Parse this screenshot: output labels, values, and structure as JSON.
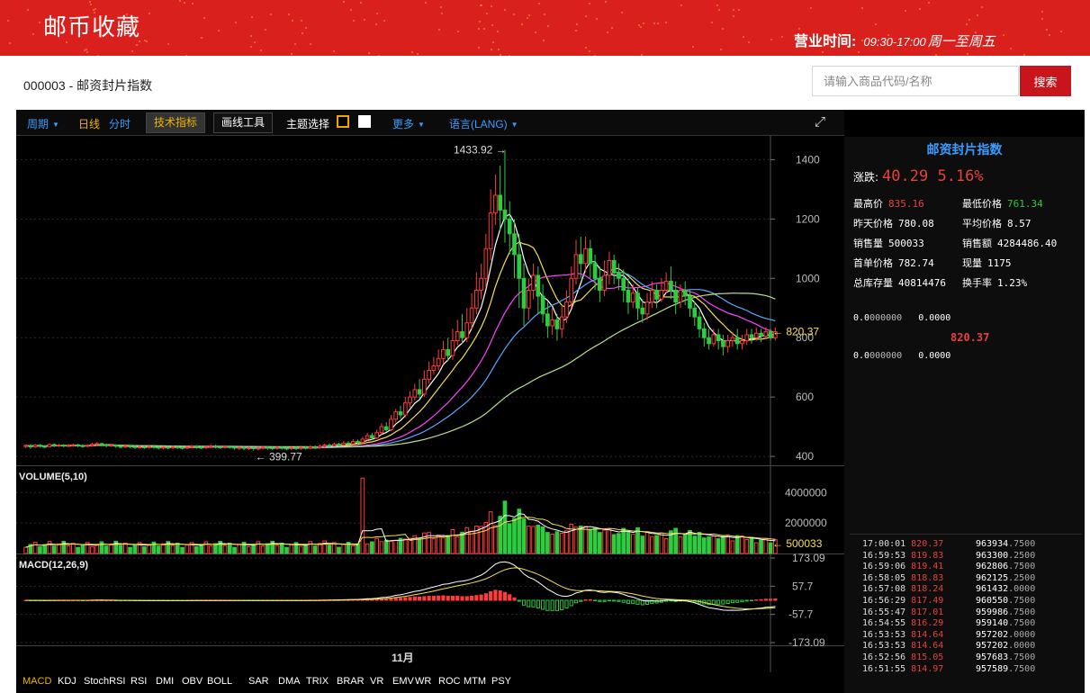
{
  "header": {
    "logo": "邮币收藏",
    "hours_label": "营业时间:",
    "hours_time": "09:30-17:00",
    "hours_days": "周一至周五"
  },
  "page": {
    "title": "000003 - 邮资封片指数"
  },
  "search": {
    "placeholder": "请输入商品代码/名称",
    "button_label": "搜索"
  },
  "toolbar": {
    "period": "周期",
    "daily": "日线",
    "intraday": "分时",
    "indicators": "技术指标",
    "drawing_tools": "画线工具",
    "theme": "主题选择",
    "more": "更多",
    "language": "语言(LANG)"
  },
  "chart_data": {
    "type": "candlestick",
    "x_label": "11月",
    "panels": [
      {
        "name": "price",
        "y_ticks": [
          1400,
          1200,
          1000,
          800,
          600,
          400
        ],
        "ylim": [
          370,
          1480
        ],
        "marks": {
          "high": "1433.92 →",
          "low": "← 399.77",
          "last": "← 820.37"
        },
        "candles": [
          [
            433,
            437,
            428,
            440
          ],
          [
            437,
            432,
            426,
            441
          ],
          [
            432,
            438,
            429,
            442
          ],
          [
            438,
            434,
            430,
            441
          ],
          [
            434,
            433,
            428,
            438
          ],
          [
            433,
            440,
            430,
            444
          ],
          [
            440,
            436,
            431,
            443
          ],
          [
            436,
            438,
            432,
            442
          ],
          [
            438,
            435,
            430,
            441
          ],
          [
            435,
            437,
            431,
            441
          ],
          [
            437,
            439,
            433,
            443
          ],
          [
            439,
            436,
            431,
            442
          ],
          [
            436,
            434,
            429,
            440
          ],
          [
            434,
            437,
            430,
            441
          ],
          [
            437,
            441,
            433,
            445
          ],
          [
            441,
            443,
            436,
            448
          ],
          [
            443,
            439,
            434,
            446
          ],
          [
            439,
            436,
            431,
            443
          ],
          [
            436,
            438,
            432,
            442
          ],
          [
            438,
            434,
            429,
            441
          ],
          [
            434,
            432,
            427,
            438
          ],
          [
            432,
            435,
            428,
            439
          ],
          [
            435,
            433,
            428,
            439
          ],
          [
            433,
            430,
            425,
            437
          ],
          [
            430,
            432,
            426,
            437
          ],
          [
            432,
            430,
            425,
            436
          ],
          [
            430,
            433,
            426,
            437
          ],
          [
            433,
            431,
            426,
            436
          ],
          [
            431,
            428,
            423,
            435
          ],
          [
            428,
            431,
            424,
            435
          ],
          [
            431,
            429,
            424,
            434
          ],
          [
            429,
            432,
            425,
            437
          ],
          [
            432,
            430,
            425,
            436
          ],
          [
            430,
            428,
            423,
            434
          ],
          [
            428,
            431,
            424,
            436
          ],
          [
            431,
            434,
            427,
            438
          ],
          [
            434,
            431,
            426,
            438
          ],
          [
            431,
            429,
            424,
            435
          ],
          [
            429,
            432,
            425,
            437
          ],
          [
            432,
            435,
            428,
            440
          ],
          [
            435,
            432,
            427,
            439
          ],
          [
            432,
            430,
            425,
            436
          ],
          [
            430,
            433,
            426,
            438
          ],
          [
            433,
            431,
            426,
            437
          ],
          [
            431,
            428,
            423,
            434
          ],
          [
            428,
            430,
            422,
            435
          ],
          [
            430,
            427,
            421,
            434
          ],
          [
            427,
            429,
            421,
            433
          ],
          [
            429,
            426,
            420,
            432
          ],
          [
            426,
            428,
            420,
            433
          ],
          [
            428,
            431,
            423,
            436
          ],
          [
            431,
            429,
            423,
            435
          ],
          [
            429,
            427,
            422,
            433
          ],
          [
            427,
            430,
            422,
            435
          ],
          [
            430,
            428,
            423,
            434
          ],
          [
            428,
            426,
            421,
            432
          ],
          [
            426,
            429,
            421,
            433
          ],
          [
            429,
            427,
            422,
            433
          ],
          [
            427,
            430,
            422,
            436
          ],
          [
            430,
            428,
            423,
            435
          ],
          [
            428,
            432,
            424,
            438
          ],
          [
            432,
            430,
            425,
            437
          ],
          [
            430,
            434,
            426,
            440
          ],
          [
            434,
            438,
            429,
            443
          ],
          [
            438,
            436,
            431,
            444
          ],
          [
            436,
            441,
            432,
            447
          ],
          [
            441,
            439,
            434,
            446
          ],
          [
            439,
            445,
            435,
            451
          ],
          [
            445,
            443,
            438,
            451
          ],
          [
            443,
            450,
            439,
            458
          ],
          [
            450,
            447,
            441,
            457
          ],
          [
            447,
            458,
            443,
            466
          ],
          [
            458,
            470,
            452,
            480
          ],
          [
            470,
            462,
            455,
            480
          ],
          [
            462,
            480,
            458,
            490
          ],
          [
            480,
            500,
            472,
            512
          ],
          [
            500,
            490,
            482,
            515
          ],
          [
            490,
            525,
            485,
            540
          ],
          [
            525,
            550,
            515,
            560
          ],
          [
            550,
            540,
            528,
            570
          ],
          [
            540,
            580,
            532,
            600
          ],
          [
            580,
            600,
            565,
            620
          ],
          [
            600,
            625,
            588,
            645
          ],
          [
            625,
            610,
            595,
            660
          ],
          [
            610,
            660,
            600,
            690
          ],
          [
            660,
            690,
            645,
            720
          ],
          [
            690,
            705,
            675,
            735
          ],
          [
            705,
            730,
            690,
            760
          ],
          [
            730,
            760,
            710,
            790
          ],
          [
            760,
            740,
            720,
            800
          ],
          [
            740,
            790,
            725,
            830
          ],
          [
            790,
            820,
            775,
            860
          ],
          [
            820,
            800,
            780,
            880
          ],
          [
            800,
            850,
            785,
            900
          ],
          [
            850,
            900,
            830,
            950
          ],
          [
            900,
            960,
            880,
            1020
          ],
          [
            960,
            1000,
            930,
            1050
          ],
          [
            1000,
            1100,
            970,
            1150
          ],
          [
            1100,
            1220,
            1060,
            1300
          ],
          [
            1220,
            1280,
            1180,
            1350
          ],
          [
            1280,
            1230,
            1160,
            1380
          ],
          [
            1230,
            1200,
            1120,
            1433
          ],
          [
            1200,
            1150,
            1080,
            1260
          ],
          [
            1150,
            1080,
            1000,
            1200
          ],
          [
            1080,
            1000,
            900,
            1150
          ],
          [
            1000,
            900,
            840,
            1050
          ],
          [
            900,
            960,
            860,
            1000
          ],
          [
            960,
            1010,
            930,
            1050
          ],
          [
            1010,
            940,
            880,
            1040
          ],
          [
            940,
            880,
            850,
            980
          ],
          [
            880,
            840,
            800,
            920
          ],
          [
            840,
            860,
            810,
            900
          ],
          [
            860,
            830,
            790,
            880
          ],
          [
            830,
            870,
            800,
            910
          ],
          [
            870,
            920,
            850,
            960
          ],
          [
            920,
            1000,
            900,
            1040
          ],
          [
            1000,
            1080,
            980,
            1130
          ],
          [
            1080,
            1050,
            1000,
            1140
          ],
          [
            1050,
            1100,
            1020,
            1140
          ],
          [
            1100,
            1050,
            1000,
            1130
          ],
          [
            1050,
            1000,
            960,
            1080
          ],
          [
            1000,
            960,
            920,
            1040
          ],
          [
            960,
            1010,
            940,
            1060
          ],
          [
            1010,
            1060,
            980,
            1090
          ],
          [
            1060,
            1020,
            980,
            1080
          ],
          [
            1020,
            1000,
            960,
            1050
          ],
          [
            1000,
            960,
            920,
            1030
          ],
          [
            960,
            920,
            880,
            1000
          ],
          [
            920,
            950,
            900,
            980
          ],
          [
            950,
            900,
            860,
            970
          ],
          [
            900,
            880,
            850,
            930
          ],
          [
            880,
            920,
            860,
            950
          ],
          [
            920,
            960,
            900,
            990
          ],
          [
            960,
            930,
            900,
            980
          ],
          [
            930,
            960,
            920,
            1000
          ],
          [
            960,
            990,
            950,
            1020
          ],
          [
            990,
            960,
            930,
            1040
          ],
          [
            960,
            920,
            880,
            990
          ],
          [
            920,
            960,
            900,
            980
          ],
          [
            960,
            940,
            910,
            990
          ],
          [
            940,
            900,
            870,
            960
          ],
          [
            900,
            870,
            840,
            920
          ],
          [
            870,
            830,
            800,
            890
          ],
          [
            830,
            800,
            770,
            850
          ],
          [
            800,
            780,
            760,
            830
          ],
          [
            780,
            810,
            770,
            830
          ],
          [
            810,
            790,
            760,
            830
          ],
          [
            790,
            770,
            740,
            810
          ],
          [
            770,
            790,
            750,
            810
          ],
          [
            790,
            800,
            770,
            820
          ],
          [
            800,
            780,
            760,
            830
          ],
          [
            780,
            790,
            760,
            810
          ],
          [
            790,
            810,
            775,
            830
          ],
          [
            810,
            800,
            780,
            830
          ],
          [
            800,
            815,
            790,
            835
          ],
          [
            815,
            805,
            785,
            830
          ],
          [
            805,
            820,
            795,
            835
          ],
          [
            820,
            800,
            790,
            830
          ],
          [
            800,
            820,
            790,
            835
          ]
        ]
      },
      {
        "name": "volume",
        "title": "VOLUME(5,10)",
        "y_ticks": [
          4000000,
          2000000
        ],
        "ylim": [
          0,
          5200000
        ],
        "last": "← 500033",
        "spike_index": 71,
        "spike_value": 4950000
      },
      {
        "name": "macd",
        "title": "MACD(12,26,9)",
        "y_ticks": [
          "173.09",
          "57.7",
          "-57.7",
          "-173.09"
        ],
        "ylim": [
          -173.09,
          173.09
        ]
      }
    ]
  },
  "sidebar": {
    "name": "邮资封片指数",
    "change_label": "涨跌:",
    "change_value": "40.29 5.16%",
    "stats": [
      {
        "k": "最高价",
        "v": "835.16",
        "color": "red"
      },
      {
        "k": "最低价格",
        "v": "761.34",
        "color": "green"
      },
      {
        "k": "昨天价格",
        "v": "780.08",
        "color": "white"
      },
      {
        "k": "平均价格",
        "v": "8.57",
        "color": "white"
      },
      {
        "k": "销售量",
        "v": "500033",
        "color": "white"
      },
      {
        "k": "销售额",
        "v": "4284486.40",
        "color": "white"
      },
      {
        "k": "首单价格",
        "v": "782.74",
        "color": "white"
      },
      {
        "k": "现量",
        "v": "1175",
        "color": "white"
      },
      {
        "k": "总库存量",
        "v": "40814476",
        "color": "white"
      },
      {
        "k": "换手率",
        "v": "1.23%",
        "color": "white"
      }
    ],
    "orderbook_row1": [
      "0.0",
      "000000",
      "0.0000"
    ],
    "orderbook_price": "820.37",
    "orderbook_row2": [
      "0.0",
      "000000",
      "0.0000"
    ],
    "trades": [
      {
        "time": "17:00:01",
        "price": "820.37",
        "vol": "963934",
        "dec": ".7500"
      },
      {
        "time": "16:59:53",
        "price": "819.83",
        "vol": "963300",
        "dec": ".2500"
      },
      {
        "time": "16:59:06",
        "price": "819.41",
        "vol": "962806",
        "dec": ".7500"
      },
      {
        "time": "16:58:05",
        "price": "818.83",
        "vol": "962125",
        "dec": ".2500"
      },
      {
        "time": "16:57:08",
        "price": "818.24",
        "vol": "961432",
        "dec": ".0000"
      },
      {
        "time": "16:56:29",
        "price": "817.49",
        "vol": "960550",
        "dec": ".7500"
      },
      {
        "time": "16:55:47",
        "price": "817.01",
        "vol": "959986",
        "dec": ".7500"
      },
      {
        "time": "16:54:55",
        "price": "816.29",
        "vol": "959140",
        "dec": ".7500"
      },
      {
        "time": "16:53:53",
        "price": "814.64",
        "vol": "957202",
        "dec": ".0000"
      },
      {
        "time": "16:53:53",
        "price": "814.64",
        "vol": "957202",
        "dec": ".0000"
      },
      {
        "time": "16:52:56",
        "price": "815.05",
        "vol": "957683",
        "dec": ".7500"
      },
      {
        "time": "16:51:55",
        "price": "814.97",
        "vol": "957589",
        "dec": ".7500"
      }
    ]
  },
  "bottom_tabs": [
    "MACD",
    "KDJ",
    "StochRSI",
    "RSI",
    "DMI",
    "OBV",
    "BOLL",
    "SAR",
    "DMA",
    "TRIX",
    "BRAR",
    "VR",
    "EMV",
    "WR",
    "ROC",
    "MTM",
    "PSY"
  ],
  "colors": {
    "up": "#ff3b3b",
    "down": "#2ecc40",
    "accent": "#d9201c",
    "ma5": "#ffffff",
    "ma10": "#f4e04d",
    "ma20": "#ff40ff",
    "ma30": "#5aa9ff",
    "ma60": "#b8e086"
  }
}
